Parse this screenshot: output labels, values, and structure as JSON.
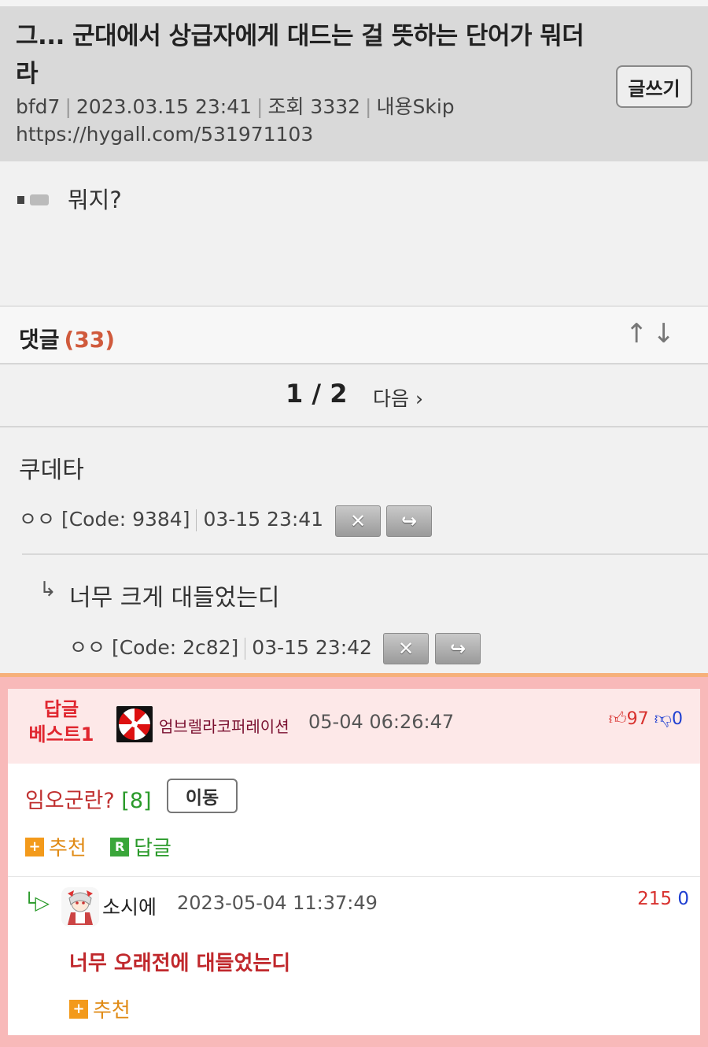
{
  "post": {
    "title": "그... 군대에서 상급자에게 대드는 걸 뜻하는 단어가 뭐더라",
    "author": "bfd7",
    "datetime": "2023.03.15 23:41",
    "views": "조회 3332",
    "skip": "내용Skip",
    "url": "https://hygall.com/531971103",
    "write_button": "글쓰기",
    "body_text": "뭐지?"
  },
  "comments_header": {
    "label": "댓글",
    "count": "(33)",
    "sort_arrows": "↑↓"
  },
  "pagination": {
    "page": "1 / 2",
    "next": "다음 ›"
  },
  "comments": [
    {
      "text": "쿠데타",
      "author": "ㅇㅇ [Code: 9384]",
      "time": "03-15 23:41",
      "delete_icon": "✕",
      "reply_icon": "↪"
    },
    {
      "reply_arrow": "↳",
      "text": "너무 크게 대들었는디",
      "author": "ㅇㅇ [Code: 2c82]",
      "time": "03-15 23:42",
      "delete_icon": "✕",
      "reply_icon": "↪"
    }
  ],
  "best_reply": {
    "label_line1": "답글",
    "label_line2": "베스트1",
    "user": "엄브렐라코퍼레이션",
    "datetime": "05-04 06:26:47",
    "up_votes": "97",
    "down_votes": "0",
    "text": "임오군란?",
    "count": "[8]",
    "move_button": "이동",
    "recommend": "추천",
    "reply": "답글",
    "plus_icon": "+",
    "r_icon": "R",
    "sub": {
      "arrow": "└▷",
      "user": "소시에",
      "datetime": "2023-05-04 11:37:49",
      "up_votes": "215",
      "down_votes": "0",
      "text": "너무 오래전에 대들었는디",
      "recommend": "추천"
    }
  },
  "colors": {
    "header_bg": "#d9d9d9",
    "accent_red": "#e0262f",
    "accent_orange": "#f39a1b",
    "accent_green": "#3aa63a",
    "best_border": "#f8b9b9"
  }
}
